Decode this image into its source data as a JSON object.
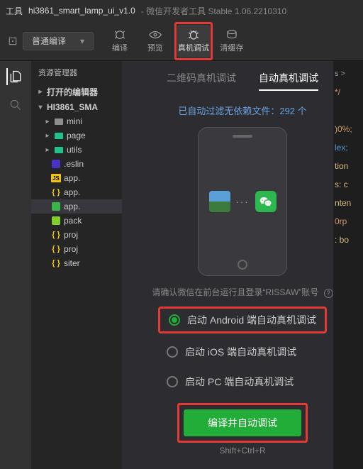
{
  "titlebar": {
    "tool_label": "工具",
    "project": "hi3861_smart_lamp_ui_v1.0",
    "app": "微信开发者工具 Stable 1.06.2210310"
  },
  "toolbar": {
    "compile_mode": "普通编译",
    "buttons": {
      "compile": "编译",
      "preview": "预览",
      "debug": "真机调试",
      "clear_cache": "清缓存"
    }
  },
  "sidebar": {
    "title": "资源管理器",
    "sections": {
      "open_editors": "打开的编辑器",
      "project": "HI3861_SMA"
    },
    "items": [
      "mini",
      "page",
      "utils",
      ".eslin",
      "app.",
      "app.",
      "pack",
      "proj",
      "proj",
      "siter"
    ]
  },
  "panel": {
    "tabs": {
      "qrcode": "二维码真机调试",
      "auto": "自动真机调试"
    },
    "filter_prefix": "已自动过滤无依赖文件：",
    "filter_count": "292 个",
    "hint": "请确认微信在前台运行且登录“RISSAW”账号",
    "radios": {
      "android": "启动 Android 端自动真机调试",
      "ios": "启动 iOS 端自动真机调试",
      "pc": "启动 PC 端自动真机调试"
    },
    "action_button": "编译并自动调试",
    "shortcut": "Shift+Ctrl+R"
  },
  "code": {
    "crumb": "s >",
    "l1": "*/",
    "l2": ")0%;",
    "l3": "lex;",
    "l4": "tion",
    "l5": "s: c",
    "l6": "nten",
    "l7": "0rp",
    "l8": ": bo"
  }
}
